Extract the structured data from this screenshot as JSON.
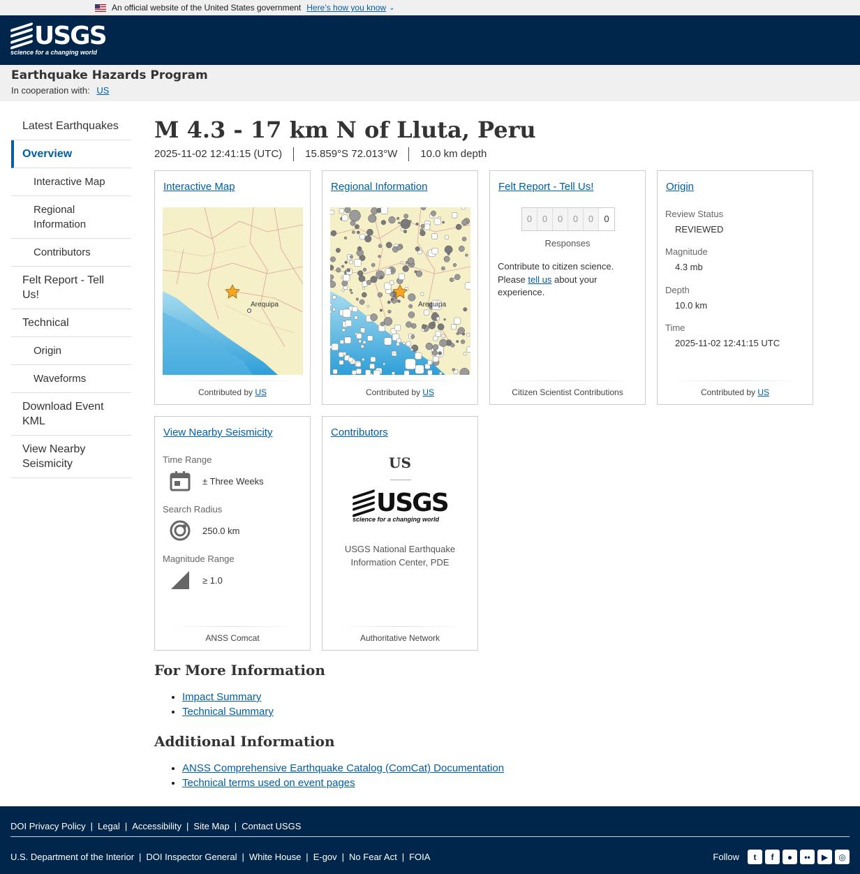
{
  "gov_banner": {
    "text": "An official website of the United States government",
    "link": "Here’s how you know"
  },
  "header": {
    "logo_text": "USGS",
    "logo_tagline": "science for a changing world"
  },
  "program": {
    "title": "Earthquake Hazards Program",
    "coop_label": "In cooperation with:",
    "coop_link": "US"
  },
  "sidebar": {
    "items": [
      {
        "label": "Latest Earthquakes"
      },
      {
        "label": "Overview"
      },
      {
        "label": "Interactive Map"
      },
      {
        "label": "Regional Information"
      },
      {
        "label": "Contributors"
      },
      {
        "label": "Felt Report - Tell Us!"
      },
      {
        "label": "Technical"
      },
      {
        "label": "Origin"
      },
      {
        "label": "Waveforms"
      },
      {
        "label": "Download Event KML"
      },
      {
        "label": "View Nearby Seismicity"
      }
    ]
  },
  "event": {
    "title": "M 4.3 - 17 km N of Lluta, Peru",
    "time": "2025-11-02 12:41:15 (UTC)",
    "location": "15.859°S 72.013°W",
    "depth": "10.0 km depth"
  },
  "cards": {
    "interactive_map": {
      "title": "Interactive Map",
      "foot_prefix": "Contributed by",
      "foot_link": "US",
      "city": "Arequipa"
    },
    "regional": {
      "title": "Regional Information",
      "foot_prefix": "Contributed by",
      "foot_link": "US",
      "city": "Arequipa"
    },
    "felt": {
      "title": "Felt Report - Tell Us!",
      "digits": [
        "0",
        "0",
        "0",
        "0",
        "0",
        "0"
      ],
      "responses_label": "Responses",
      "text_before": "Contribute to citizen science. Please",
      "text_link": "tell us",
      "text_after": "about your experience.",
      "foot": "Citizen Scientist Contributions"
    },
    "origin": {
      "title": "Origin",
      "review_status_label": "Review Status",
      "review_status": "REVIEWED",
      "magnitude_label": "Magnitude",
      "magnitude": "4.3 mb",
      "depth_label": "Depth",
      "depth": "10.0 km",
      "time_label": "Time",
      "time": "2025-11-02 12:41:15 UTC",
      "foot_prefix": "Contributed by",
      "foot_link": "US"
    },
    "nearby": {
      "title": "View Nearby Seismicity",
      "time_range_label": "Time Range",
      "time_range": "± Three Weeks",
      "radius_label": "Search Radius",
      "radius": "250.0 km",
      "mag_label": "Magnitude Range",
      "mag": "≥ 1.0",
      "foot": "ANSS Comcat"
    },
    "contributors": {
      "title": "Contributors",
      "network": "US",
      "logo_text": "USGS",
      "logo_tagline": "science for a changing world",
      "name": "USGS National Earthquake Information Center, PDE",
      "foot": "Authoritative Network"
    }
  },
  "more_info": {
    "heading": "For More Information",
    "links": [
      "Impact Summary",
      "Technical Summary"
    ]
  },
  "additional_info": {
    "heading": "Additional Information",
    "links": [
      "ANSS Comprehensive Earthquake Catalog (ComCat) Documentation",
      "Technical terms used on event pages"
    ]
  },
  "footer": {
    "row1": [
      "DOI Privacy Policy",
      "Legal",
      "Accessibility",
      "Site Map",
      "Contact USGS"
    ],
    "row2": [
      "U.S. Department of the Interior",
      "DOI Inspector General",
      "White House",
      "E-gov",
      "No Fear Act",
      "FOIA"
    ],
    "follow": "Follow",
    "social_icons": [
      "twitter-icon",
      "facebook-icon",
      "github-icon",
      "flickr-icon",
      "youtube-icon",
      "instagram-icon"
    ]
  },
  "colors": {
    "header_bg": "#00264c",
    "link": "#005ea2",
    "banner_bg": "#f0f0f0"
  }
}
